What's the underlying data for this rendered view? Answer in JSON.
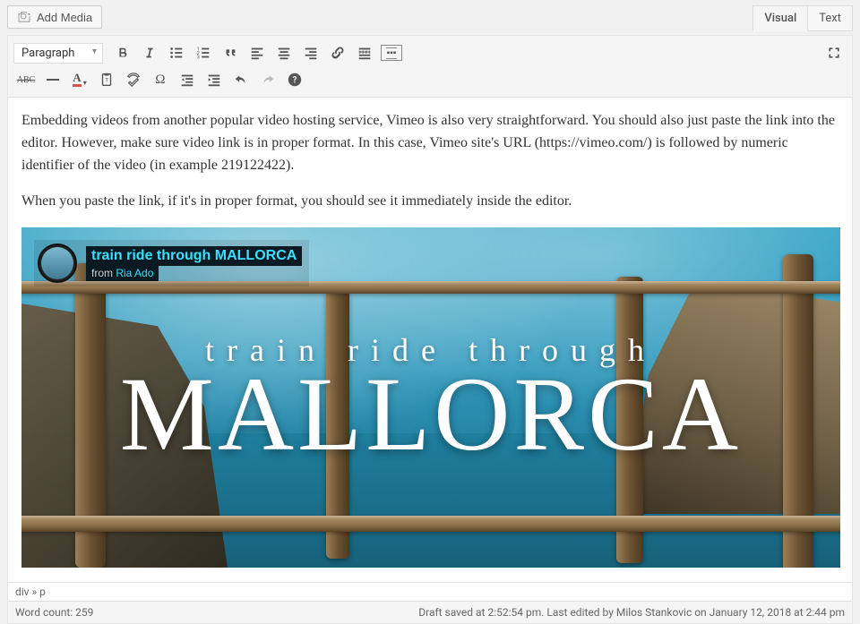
{
  "top": {
    "add_media": "Add Media",
    "tabs": {
      "visual": "Visual",
      "text": "Text"
    }
  },
  "toolbar": {
    "format": "Paragraph"
  },
  "content": {
    "p1": "Embedding videos from another popular video hosting service, Vimeo is also very straightforward. You should also just paste the link into the editor. However, make sure video link is in proper format. In this case, Vimeo site's URL (https://vimeo.com/) is followed by numeric identifier of the video (in example 219122422).",
    "p2": "When you paste the link, if it's in proper format, you should see it immediately inside the editor."
  },
  "video": {
    "title": "train ride through MALLORCA",
    "from_prefix": "from ",
    "author": "Ria Ado",
    "overlay_top": "train ride through",
    "overlay_big": "MALLORCA"
  },
  "path": "div » p",
  "status": {
    "left": "Word count: 259",
    "right": "Draft saved at 2:52:54 pm. Last edited by Milos Stankovic on January 12, 2018 at 2:44 pm"
  }
}
